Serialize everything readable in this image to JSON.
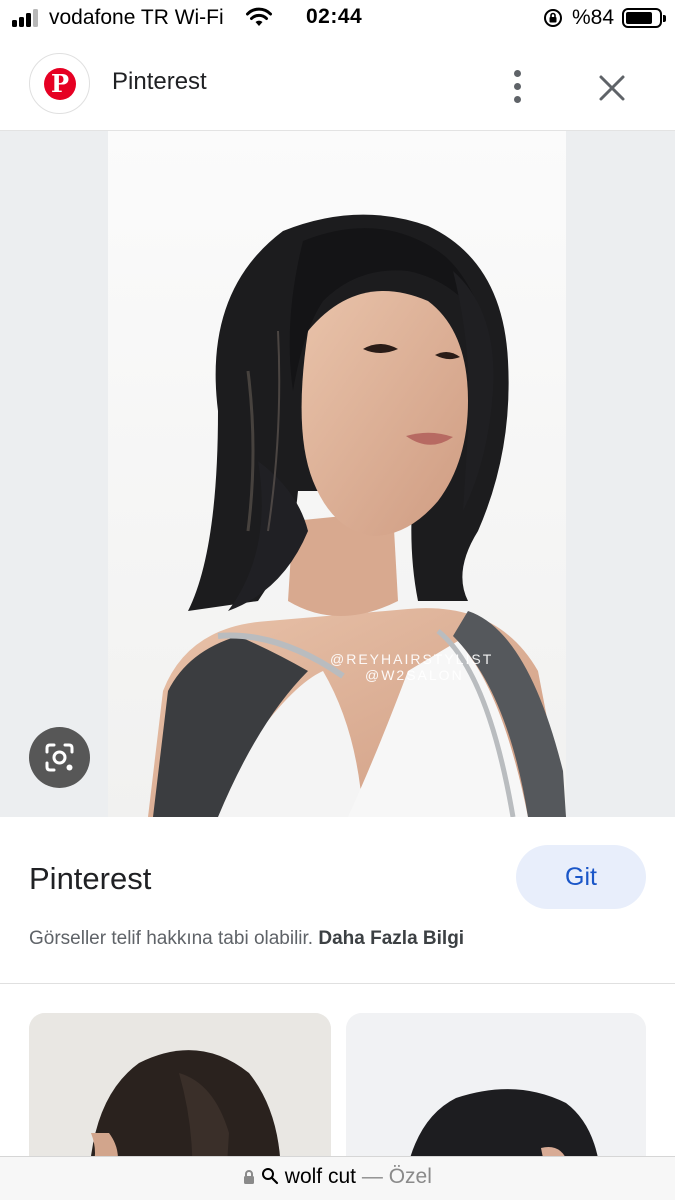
{
  "status_bar": {
    "carrier": "vodafone TR Wi-Fi",
    "time": "02:44",
    "battery_percent": "%84",
    "battery_level": 0.84
  },
  "header": {
    "site_title": "Pinterest"
  },
  "image": {
    "watermark_line1": "@REYHAIRSTYLIST",
    "watermark_line2": "@W2SALON"
  },
  "source": {
    "name": "Pinterest",
    "visit_label": "Git",
    "copyright_text": "Görseller telif hakkına tabi olabilir.",
    "learn_more": "Daha Fazla Bilgi"
  },
  "url_bar": {
    "query": "wolf cut",
    "separator": "—",
    "mode": "Özel"
  },
  "colors": {
    "brand": "#e60023",
    "visit_button_bg": "#e8eefb",
    "visit_button_text": "#1a56c8"
  }
}
